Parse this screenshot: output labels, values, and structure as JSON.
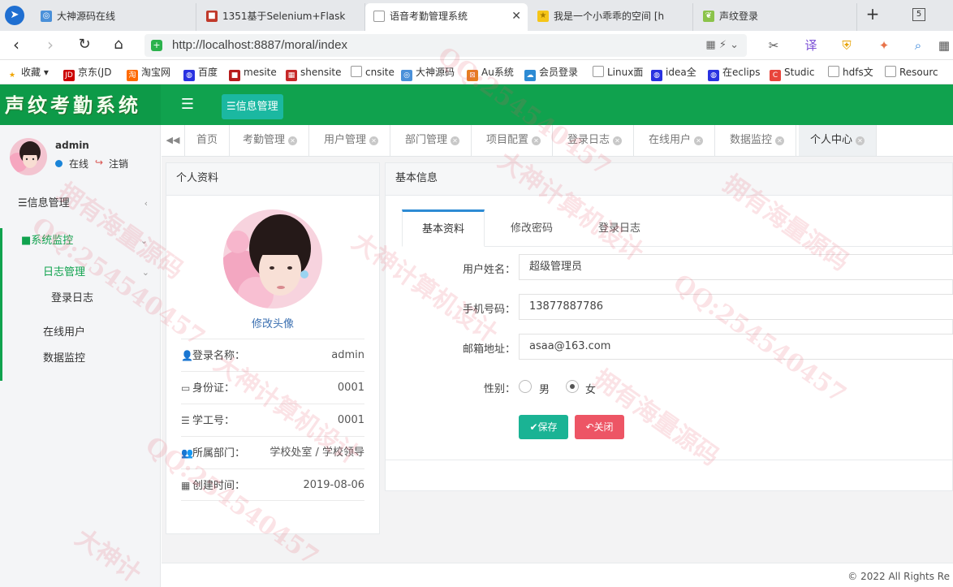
{
  "browser": {
    "tabs": [
      {
        "title": "大神源码在线"
      },
      {
        "title": "1351基于Selenium+Flask"
      },
      {
        "title": "语音考勤管理系统"
      },
      {
        "title": "我是一个小乖乖的空间 [h"
      },
      {
        "title": "声纹登录"
      }
    ],
    "tab_count": "5",
    "url": "http://localhost:8887/moral/index",
    "bookmarks": [
      "收藏",
      "京东(JD",
      "淘宝网",
      "百度",
      "mesite",
      "shensite",
      "cnsite",
      "大神源码",
      "Au系统",
      "会员登录",
      "Linux面",
      "idea全",
      "在eclips",
      "Studic",
      "hdfs文",
      "Resourc"
    ]
  },
  "app": {
    "logo": "声纹考勤系统",
    "top_menu": "信息管理"
  },
  "user": {
    "name": "admin",
    "status": "在线",
    "logout": "注销"
  },
  "sidebar": {
    "items": [
      {
        "label": "信息管理"
      },
      {
        "label": "系统监控"
      },
      {
        "label": "日志管理"
      },
      {
        "label": "登录日志"
      },
      {
        "label": "在线用户"
      },
      {
        "label": "数据监控"
      }
    ]
  },
  "content_tabs": [
    "首页",
    "考勤管理",
    "用户管理",
    "部门管理",
    "项目配置",
    "登录日志",
    "在线用户",
    "数据监控",
    "个人中心"
  ],
  "profile": {
    "title": "个人资料",
    "change_avatar": "修改头像",
    "rows": [
      {
        "label": "登录名称：",
        "value": "admin"
      },
      {
        "label": "身份证：",
        "value": "0001"
      },
      {
        "label": "学工号：",
        "value": "0001"
      },
      {
        "label": "所属部门：",
        "value": "学校处室 / 学校领导"
      },
      {
        "label": "创建时间：",
        "value": "2019-08-06"
      }
    ]
  },
  "basic_info": {
    "title": "基本信息",
    "tabs": [
      "基本资料",
      "修改密码",
      "登录日志"
    ],
    "fields": [
      {
        "label": "用户姓名：",
        "value": "超级管理员"
      },
      {
        "label": "手机号码：",
        "value": "13877887786"
      },
      {
        "label": "邮箱地址：",
        "value": "asaa@163.com"
      }
    ],
    "gender_label": "性别：",
    "gender_options": [
      "男",
      "女"
    ],
    "gender_selected": "女",
    "save_button": "保存",
    "close_button": "关闭"
  },
  "footer": "© 2022 All Rights Re",
  "watermarks": [
    "大神计算机设计",
    "QQ:254540457",
    "拥有海量源码",
    "大神计算机设计",
    "QQ:254540457",
    "拥有海量源码",
    "QQ:254540457",
    "大神计算机设计",
    "拥有海量源码",
    "QQ:254540457",
    "大神计"
  ],
  "colors": {
    "brand": "#10a24e",
    "save": "#1ab394",
    "close": "#ed5565",
    "link": "#3a6fb0"
  }
}
